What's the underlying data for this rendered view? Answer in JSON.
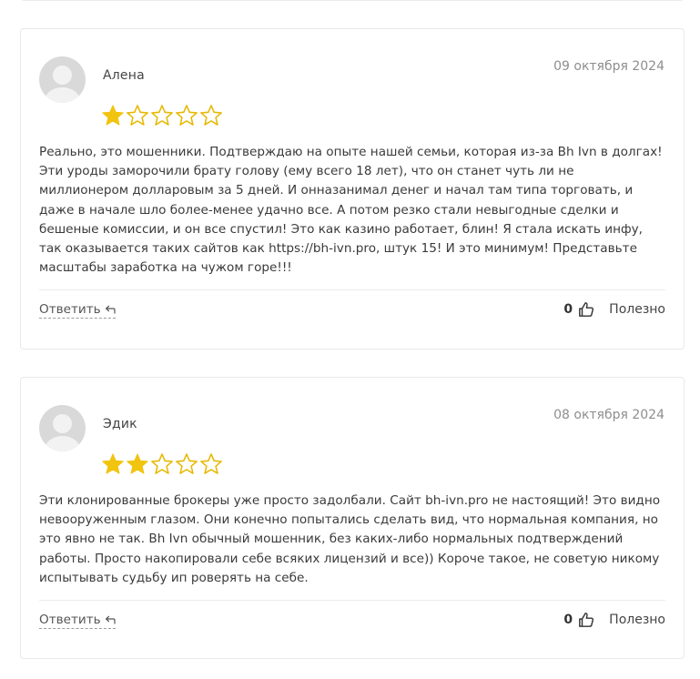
{
  "reviews": [
    {
      "author": "Алена",
      "date": "09 октября 2024",
      "rating": 1,
      "max_rating": 5,
      "text": "Реально, это мошенники. Подтверждаю на опыте нашей семьи, которая из-за Bh Ivn в долгах! Эти уроды заморочили брату голову (ему всего 18 лет), что он станет чуть ли не миллионером долларовым за 5 дней. И онназанимал денег и начал там типа торговать, и даже в начале шло более-менее удачно все. А потом резко стали невыгодные сделки и бешеные комиссии, и он все спустил! Это как казино работает, блин! Я стала искать инфу, так оказывается таких сайтов как https://bh-ivn.pro, штук 15! И это минимум! Представьте масштабы заработка на чужом горе!!!",
      "reply_label": "Ответить",
      "votes": "0",
      "useful_label": "Полезно"
    },
    {
      "author": "Эдик",
      "date": "08 октября 2024",
      "rating": 2,
      "max_rating": 5,
      "text": "Эти клонированные брокеры уже просто задолбали. Сайт bh-ivn.pro не настоящий! Это видно невооруженным глазом. Они конечно попытались сделать вид, что нормальная компания, но это явно не так. Bh Ivn обычный мошенник, без каких-либо нормальных подтверждений работы. Просто накопировали себе всяких лицензий и все)) Короче такое, не советую никому испытывать судьбу ип ровeрять на себе.",
      "reply_label": "Ответить",
      "votes": "0",
      "useful_label": "Полезно"
    }
  ],
  "colors": {
    "star_filled": "#f1c40f",
    "star_empty_stroke": "#e6b800",
    "card_border": "#e9e9e9",
    "date": "#8e8e8e"
  },
  "icons": {
    "avatar": "default-user-avatar",
    "reply": "reply-arrow-icon",
    "like": "thumbs-up-icon",
    "star": "star-icon"
  }
}
